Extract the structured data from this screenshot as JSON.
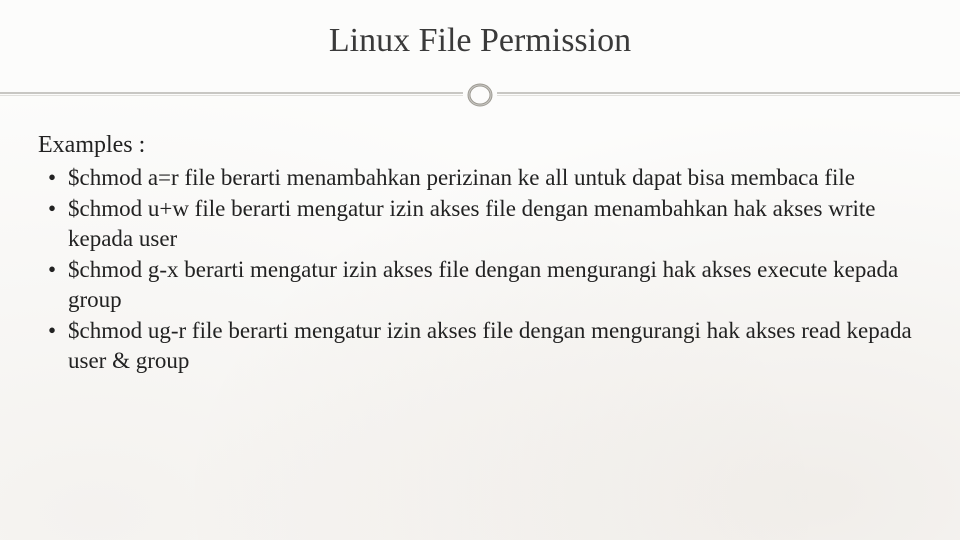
{
  "title": "Linux File Permission",
  "heading": "Examples :",
  "items": [
    {
      "cmd": "$chmod a=r file",
      "rest": " berarti menambahkan perizinan ke all untuk dapat bisa membaca file"
    },
    {
      "cmd": "$chmod u+w file",
      "rest": " berarti mengatur izin akses file dengan menambahkan hak akses write kepada user"
    },
    {
      "cmd": "$chmod g-x",
      "rest": " berarti mengatur izin akses file dengan mengurangi hak akses execute kepada group"
    },
    {
      "cmd": "$chmod ug-r",
      "rest": " file berarti mengatur izin akses file dengan mengurangi hak akses read kepada user & group"
    }
  ]
}
